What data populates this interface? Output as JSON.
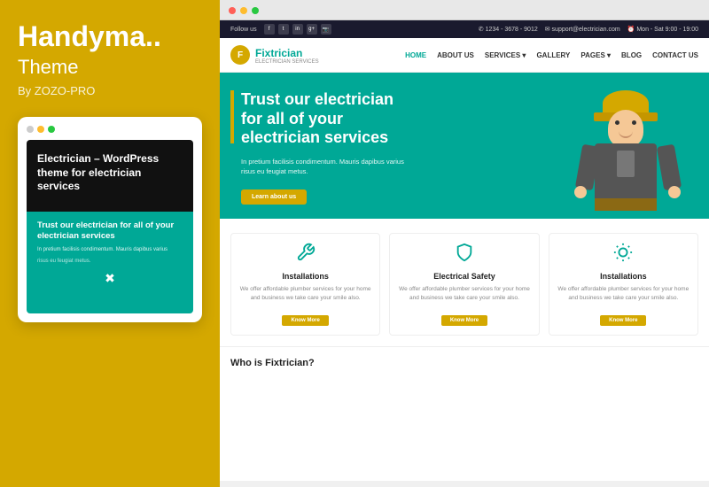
{
  "leftPanel": {
    "themeTitle": "Handyma..",
    "themeSubtitle": "Theme",
    "themeAuthor": "By ZOZO-PRO",
    "mobilePreview": {
      "screenTitle": "Electrician – WordPress theme for electrician services",
      "heroTitle": "Trust our electrician for all of your electrician services",
      "heroSubtitle": "In pretium facilisis condimentum. Mauris dapibus varius",
      "heroSub2": "risus eu feugiat metus."
    }
  },
  "browser": {
    "topbar": {
      "followUs": "Follow us",
      "phone": "✆  1234 - 3678 - 9012",
      "email": "✉  support@electrician.com",
      "hours": "⏰  Mon - Sat 9:00 - 19:00"
    },
    "nav": {
      "logoText": "Fixtrician",
      "logoSubtext": "ELECTRICIAN SERVICES",
      "links": [
        "HOME",
        "ABOUT US",
        "SERVICES ▾",
        "GALLERY",
        "PAGES ▾",
        "BLOG",
        "CONTACT US"
      ]
    },
    "hero": {
      "title": "Trust our electrician\nfor all of your\nelectrician services",
      "description": "In pretium facilisis condimentum. Mauris dapibus varius\nrisus eu feugiat metus.",
      "buttonLabel": "Learn about us"
    },
    "services": [
      {
        "icon": "⚙",
        "title": "Installations",
        "description": "We offer affordable plumber services for your home and business we take care your smile also.",
        "btnLabel": "Know More"
      },
      {
        "icon": "🛡",
        "title": "Electrical Safety",
        "description": "We offer affordable plumber services for your home and business we take care your smile also.",
        "btnLabel": "Know More"
      },
      {
        "icon": "💡",
        "title": "Installations",
        "description": "We offer affordable plumber services for your home and business we take care your smile also.",
        "btnLabel": "Know More"
      }
    ],
    "footerHeading": "Who is Fixtrician?"
  },
  "colors": {
    "gold": "#d4a800",
    "teal": "#00a896",
    "dark": "#111",
    "white": "#ffffff"
  }
}
